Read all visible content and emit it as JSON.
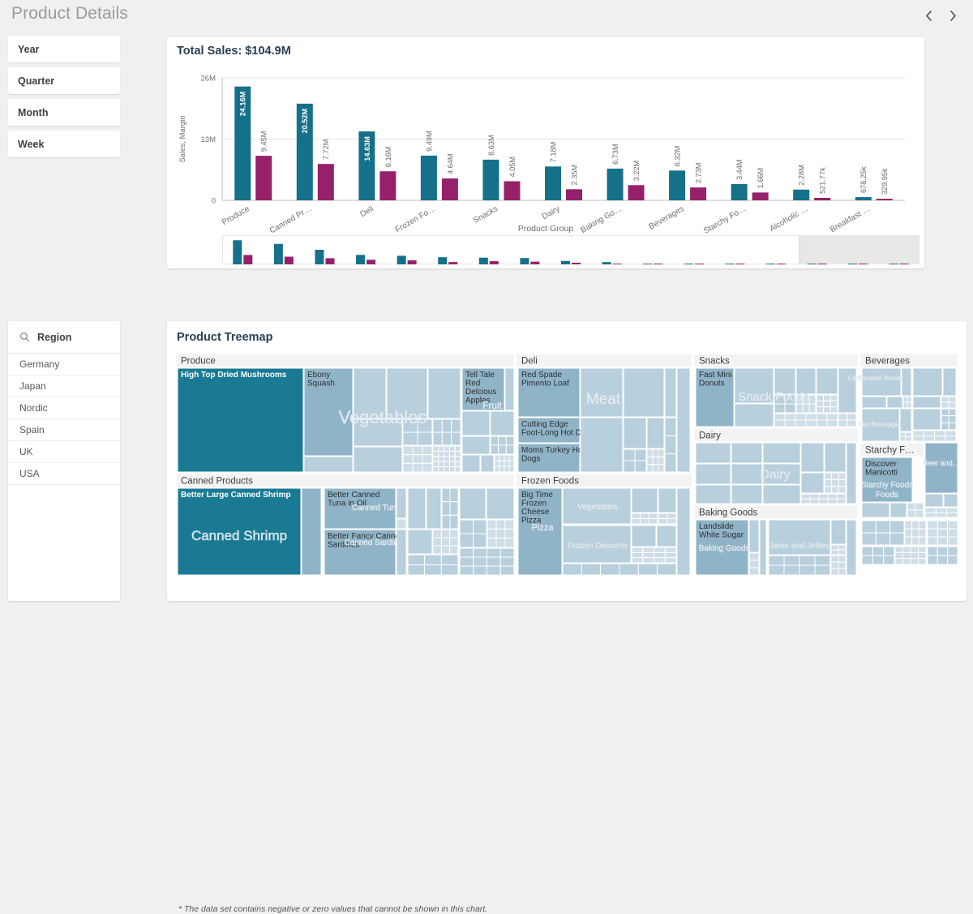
{
  "header": {
    "title": "Product Details",
    "prev_icon": "chevron-left-icon",
    "next_icon": "chevron-right-icon"
  },
  "filters": {
    "buttons": [
      {
        "label": "Year"
      },
      {
        "label": "Quarter"
      },
      {
        "label": "Month"
      },
      {
        "label": "Week"
      }
    ]
  },
  "region_filter": {
    "title": "Region",
    "search_icon": "search-icon",
    "items": [
      "Germany",
      "Japan",
      "Nordic",
      "Spain",
      "UK",
      "USA"
    ]
  },
  "barchart": {
    "title": "Total Sales: $104.9M",
    "colors": {
      "sales": "#15708a",
      "margin": "#96216a"
    }
  },
  "treemap": {
    "title": "Product Treemap",
    "footnote": "* The data set contains negative or zero values that cannot be shown in this chart.",
    "colors": {
      "dark": "#1a7a94",
      "mid": "#8fb4c8",
      "light": "#b8cfdd",
      "pale": "#cfdde6",
      "header_bg": "#f2f3f4"
    },
    "groups": [
      {
        "name": "Produce",
        "overlays": [
          "Vegetables",
          "Fruit"
        ],
        "items": [
          "High Top Dried Mushrooms",
          "Ebony Squash",
          "Tell Tale Red Delcious Apples"
        ]
      },
      {
        "name": "Canned Products",
        "overlays": [
          "Canned Shrimp",
          "Canned Tuna",
          "Canned Sardines"
        ],
        "items": [
          "Better Large Canned Shrimp",
          "Better Canned Tuna in Oil",
          "Better Fancy Canned Sardines"
        ]
      },
      {
        "name": "Deli",
        "overlays": [
          "Meat"
        ],
        "items": [
          "Red Spade Pimento Loaf",
          "Cutting Edge Foot-Long Hot D…",
          "Moms Turkey Hot Dogs"
        ]
      },
      {
        "name": "Frozen Foods",
        "overlays": [
          "Pizza",
          "Vegetables",
          "Frozen Desserts"
        ],
        "items": [
          "Big Time Frozen Cheese Pizza"
        ]
      },
      {
        "name": "Snacks",
        "overlays": [
          "Snack Foods"
        ],
        "items": [
          "Fast Mini Donuts"
        ]
      },
      {
        "name": "Dairy",
        "overlays": [
          "Dairy"
        ],
        "items": []
      },
      {
        "name": "Baking Goods",
        "overlays": [
          "Baking Goods",
          "Jams and Jellies"
        ],
        "items": [
          "Landslide White Sugar"
        ]
      },
      {
        "name": "Beverages",
        "overlays": [
          "Carbonated Beverages",
          "Hot Beverages"
        ],
        "items": []
      },
      {
        "name": "Starchy F…",
        "overlays": [
          "Starchy Foods",
          "Beer and…"
        ],
        "items": [
          "Discover Manicotti"
        ]
      }
    ]
  },
  "chart_data": {
    "type": "bar",
    "title": "Total Sales: $104.9M",
    "xlabel": "Product Group",
    "ylabel": "Sales, Margin",
    "ylim": [
      0,
      26000000
    ],
    "yticks": [
      "0",
      "13M",
      "26M"
    ],
    "grid": true,
    "legend": "none",
    "categories": [
      "Produce",
      "Canned Pr…",
      "Deli",
      "Frozen Fo…",
      "Snacks",
      "Dairy",
      "Baking Go…",
      "Beverages",
      "Starchy Fo…",
      "Alcoholic …",
      "Breakfast …"
    ],
    "series": [
      {
        "name": "Sales",
        "color": "#15708a",
        "values": [
          24160000,
          20520000,
          14630000,
          9490000,
          8630000,
          7180000,
          6730000,
          6320000,
          3440000,
          2280000,
          678250
        ],
        "labels": [
          "24.16M",
          "20.52M",
          "14.63M",
          "9.49M",
          "8.63M",
          "7.18M",
          "6.73M",
          "6.32M",
          "3.44M",
          "2.28M",
          "678.25k"
        ]
      },
      {
        "name": "Margin",
        "color": "#96216a",
        "values": [
          9450000,
          7720000,
          6160000,
          4640000,
          4050000,
          2350000,
          3220000,
          2730000,
          1660000,
          521770,
          329950
        ],
        "labels": [
          "9.45M",
          "7.72M",
          "6.16M",
          "4.64M",
          "4.05M",
          "2.35M",
          "3.22M",
          "2.73M",
          "1.66M",
          "521.77k",
          "329.95k"
        ]
      }
    ]
  }
}
